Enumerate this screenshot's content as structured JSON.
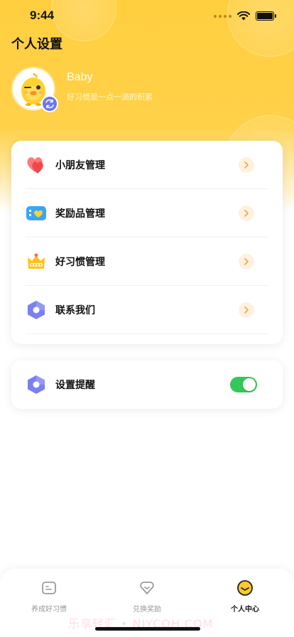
{
  "status_bar": {
    "time": "9:44"
  },
  "page": {
    "title": "个人设置"
  },
  "profile": {
    "name": "Baby",
    "motto": "好习惯是一点一滴的积累"
  },
  "menu": {
    "items": [
      {
        "label": "小朋友管理",
        "icon": "hearts-icon"
      },
      {
        "label": "奖励品管理",
        "icon": "reward-box-icon"
      },
      {
        "label": "好习惯管理",
        "icon": "crown-icon"
      },
      {
        "label": "联系我们",
        "icon": "hexagon-icon"
      }
    ]
  },
  "reminder": {
    "label": "设置提醒",
    "enabled": true
  },
  "tabs": [
    {
      "label": "养成好习惯",
      "icon": "habit-icon",
      "active": false
    },
    {
      "label": "兑换奖励",
      "icon": "exchange-icon",
      "active": false
    },
    {
      "label": "个人中心",
      "icon": "profile-center-icon",
      "active": true
    }
  ],
  "watermark": "乐享轻汇 • NJYCQH.COM",
  "colors": {
    "accent": "#ffcf3f",
    "toggle_on": "#34c759",
    "badge": "#6b76f0"
  }
}
